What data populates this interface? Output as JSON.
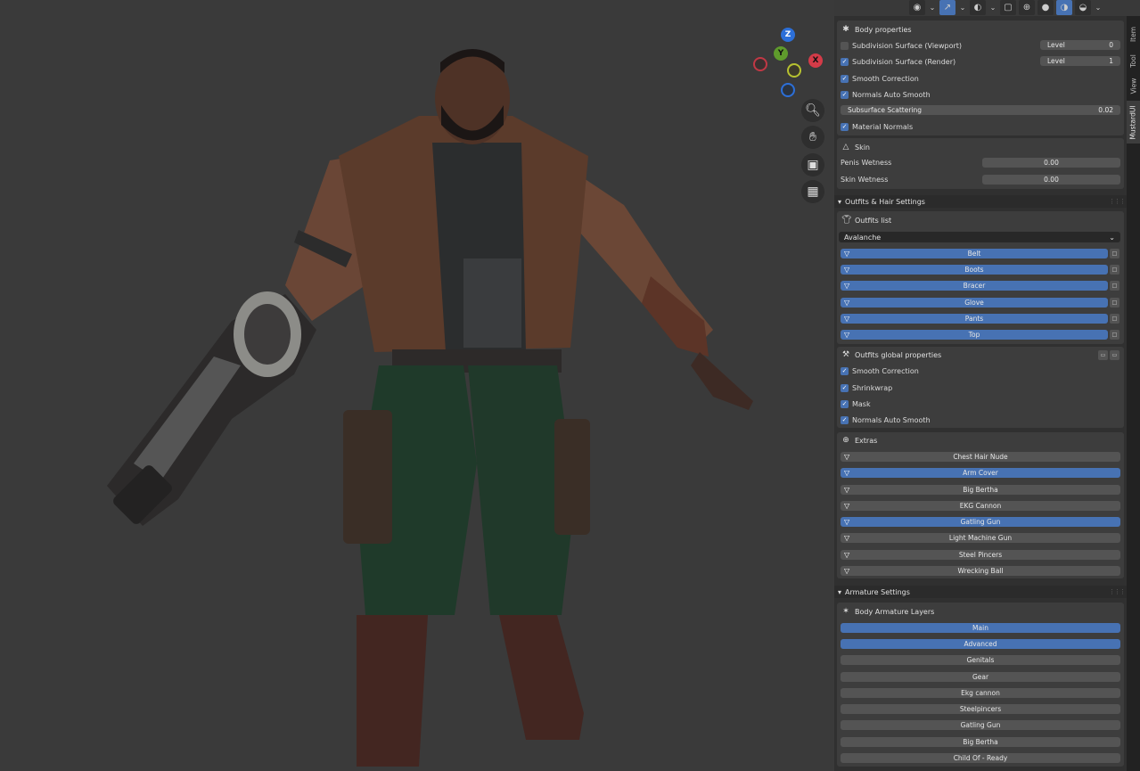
{
  "viewport": {
    "header_icons": [
      "eye-icon",
      "gizmo-icon",
      "overlay-icon",
      "xray-icon",
      "wireframe-shading-icon",
      "solid-shading-icon",
      "material-shading-icon",
      "rendered-shading-icon"
    ],
    "gizmo": {
      "z": "Z",
      "y": "Y",
      "x": "X"
    },
    "nav_icons": [
      "zoom-icon",
      "hand-icon",
      "camera-icon",
      "grid-icon"
    ]
  },
  "tabs": [
    "Item",
    "Tool",
    "View",
    "MustardUI"
  ],
  "body_properties": {
    "title": "Body properties",
    "subdiv_viewport": {
      "label": "Subdivision Surface (Viewport)",
      "checked": false,
      "level_label": "Level",
      "level_value": "0"
    },
    "subdiv_render": {
      "label": "Subdivision Surface (Render)",
      "checked": true,
      "level_label": "Level",
      "level_value": "1"
    },
    "smooth_correction": "Smooth Correction",
    "normals_auto_smooth": "Normals Auto Smooth",
    "sss": {
      "label": "Subsurface Scattering",
      "value": "0.02"
    },
    "material_normals": "Material Normals"
  },
  "skin": {
    "title": "Skin",
    "rows": [
      {
        "label": "Penis Wetness",
        "value": "0.00"
      },
      {
        "label": "Skin Wetness",
        "value": "0.00"
      }
    ]
  },
  "outfits_section": {
    "title": "Outfits & Hair Settings",
    "list_title": "Outfits list",
    "selected": "Avalanche",
    "items": [
      "Belt",
      "Boots",
      "Bracer",
      "Glove",
      "Pants",
      "Top"
    ],
    "global_title": "Outfits global properties",
    "global_options": [
      "Smooth Correction",
      "Shrinkwrap",
      "Mask",
      "Normals Auto Smooth"
    ]
  },
  "extras": {
    "title": "Extras",
    "items": [
      {
        "label": "Chest Hair Nude",
        "on": false
      },
      {
        "label": "Arm Cover",
        "on": true
      },
      {
        "label": "Big Bertha",
        "on": false
      },
      {
        "label": "EKG Cannon",
        "on": false
      },
      {
        "label": "Gatling Gun",
        "on": true
      },
      {
        "label": "Light Machine Gun",
        "on": false
      },
      {
        "label": "Steel Pincers",
        "on": false
      },
      {
        "label": "Wrecking Ball",
        "on": false
      }
    ]
  },
  "armature": {
    "title": "Armature Settings",
    "layers_title": "Body Armature Layers",
    "layers": [
      {
        "label": "Main",
        "on": true
      },
      {
        "label": "Advanced",
        "on": true
      },
      {
        "label": "Genitals",
        "on": false
      },
      {
        "label": "Gear",
        "on": false
      },
      {
        "label": "Ekg cannon",
        "on": false
      },
      {
        "label": "Steelpincers",
        "on": false
      },
      {
        "label": "Gatling Gun",
        "on": false
      },
      {
        "label": "Big Bertha",
        "on": false
      },
      {
        "label": "Child Of - Ready",
        "on": false
      }
    ]
  }
}
